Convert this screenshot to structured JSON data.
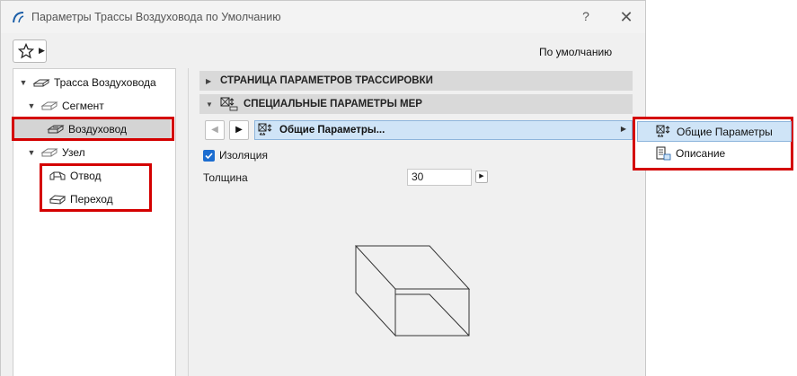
{
  "window": {
    "title": "Параметры Трассы Воздуховода по Умолчанию",
    "help_label": "?",
    "close_label": "✕"
  },
  "toolbar": {
    "favorites_icon": "star-icon",
    "default_label": "По умолчанию"
  },
  "tree": {
    "items": [
      {
        "label": "Трасса Воздуховода",
        "level": 0,
        "expanded": true,
        "icon": "route-icon"
      },
      {
        "label": "Сегмент",
        "level": 1,
        "expanded": true,
        "icon": "segment-icon"
      },
      {
        "label": "Воздуховод",
        "level": 2,
        "selected": true,
        "icon": "duct-icon"
      },
      {
        "label": "Узел",
        "level": 1,
        "expanded": true,
        "icon": "node-icon"
      },
      {
        "label": "Отвод",
        "level": 2,
        "icon": "elbow-icon"
      },
      {
        "label": "Переход",
        "level": 2,
        "icon": "transition-icon"
      }
    ]
  },
  "sections": {
    "routing_page": "СТРАНИЦА ПАРАМЕТРОВ ТРАССИРОВКИ",
    "special_params": "СПЕЦИАЛЬНЫЕ ПАРАМЕТРЫ MEP"
  },
  "page_nav": {
    "prev_label": "◀",
    "next_label": "▶",
    "current_page": "Общие Параметры...",
    "caret": "▶"
  },
  "params": {
    "insulation_label": "Изоляция",
    "insulation_checked": true,
    "thickness_label": "Толщина",
    "thickness_value": "30"
  },
  "popup_menu": {
    "items": [
      {
        "label": "Общие Параметры",
        "selected": true,
        "icon": "general-params-icon"
      },
      {
        "label": "Описание",
        "selected": false,
        "icon": "description-icon"
      }
    ]
  },
  "colors": {
    "highlight": "#d40000",
    "selection": "#cfe4f7",
    "checkbox": "#1c6dd0"
  }
}
